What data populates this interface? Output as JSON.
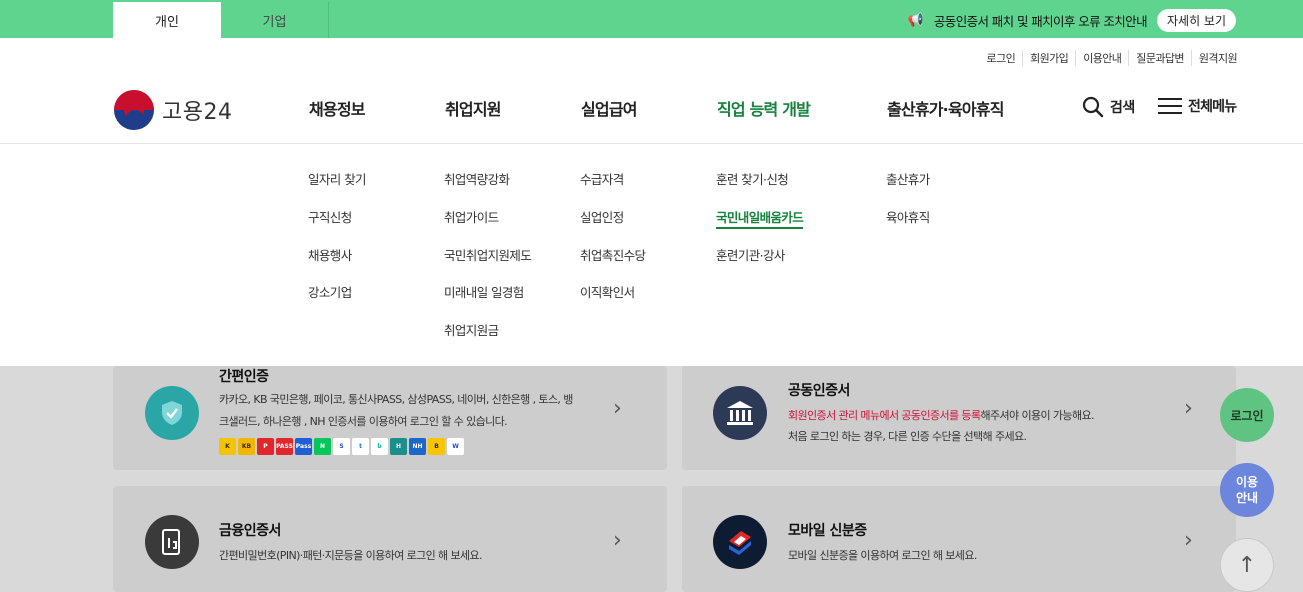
{
  "tabs": {
    "personal": "개인",
    "business": "기업"
  },
  "notice": {
    "text": "공동인증서 패치 및 패치이후 오류 조치안내",
    "button": "자세히 보기"
  },
  "util_links": [
    "로그인",
    "회원가입",
    "이용안내",
    "질문과답변",
    "원격지원"
  ],
  "logo": {
    "text": "고용24"
  },
  "nav": [
    {
      "label": "채용정보",
      "items": [
        "일자리 찾기",
        "구직신청",
        "채용행사",
        "강소기업"
      ]
    },
    {
      "label": "취업지원",
      "items": [
        "취업역량강화",
        "취업가이드",
        "국민취업지원제도",
        "미래내일 일경험",
        "취업지원금"
      ]
    },
    {
      "label": "실업급여",
      "items": [
        "수급자격",
        "실업인정",
        "취업촉진수당",
        "이직확인서"
      ]
    },
    {
      "label": "직업 능력 개발",
      "items": [
        "훈련 찾기·신청",
        "국민내일배움카드",
        "훈련기관·강사"
      ]
    },
    {
      "label": "출산휴가·육아휴직",
      "items": [
        "출산휴가",
        "육아휴직"
      ]
    }
  ],
  "search": {
    "label": "검색"
  },
  "all_menu": {
    "label": "전체메뉴"
  },
  "cards": {
    "simple": {
      "title": "간편인증",
      "desc1": "카카오, KB 국민은행, 페이코, 통신사PASS, 삼성PASS, 네이버, 신한은행 , 토스, 뱅",
      "desc2": "크샐러드, 하나은행 , NH 인증서를 이용하여 로그인 할 수 있습니다."
    },
    "joint": {
      "title": "공동인증서",
      "desc_red": "회원인증서 관리 메뉴에서 공동인증서를 등록",
      "desc_rest": "해주셔야 이용이 가능해요.",
      "desc2": "처음 로그인 하는 경우, 다른 인증 수단을 선택해 주세요."
    },
    "finance": {
      "title": "금융인증서",
      "desc": "간편비밀번호(PIN)·패턴·지문등을 이용하여 로그인 해 보세요."
    },
    "mobile": {
      "title": "모바일 신분증",
      "desc": "모바일 신분증을 이용하여 로그인 해 보세요."
    }
  },
  "float": {
    "login": "로그인",
    "guide1": "이용",
    "guide2": "안내",
    "top": "↑"
  },
  "colors": {
    "brand_green": "#5fd48f",
    "active_green": "#17803f"
  }
}
